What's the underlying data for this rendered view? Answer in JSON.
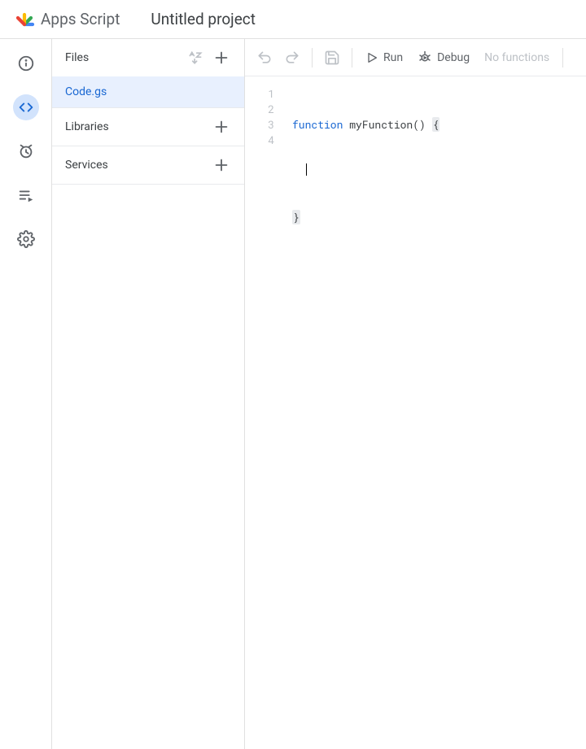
{
  "header": {
    "product_name": "Apps Script",
    "project_title": "Untitled project"
  },
  "nav": {
    "items": [
      {
        "name": "overview",
        "icon": "info"
      },
      {
        "name": "editor",
        "icon": "code",
        "active": true
      },
      {
        "name": "triggers",
        "icon": "alarm"
      },
      {
        "name": "executions",
        "icon": "playlist"
      },
      {
        "name": "settings",
        "icon": "gear"
      }
    ]
  },
  "file_panel": {
    "files_label": "Files",
    "file_name": "Code.gs",
    "libraries_label": "Libraries",
    "services_label": "Services"
  },
  "toolbar": {
    "run_label": "Run",
    "debug_label": "Debug",
    "functions_label": "No functions"
  },
  "editor": {
    "line_numbers": [
      "1",
      "2",
      "3",
      "4"
    ],
    "tokens": {
      "keyword_function": "function",
      "fn_name": " myFunction",
      "parens": "()",
      "space": " ",
      "open_brace": "{",
      "indent": "  ",
      "close_brace": "}"
    }
  }
}
